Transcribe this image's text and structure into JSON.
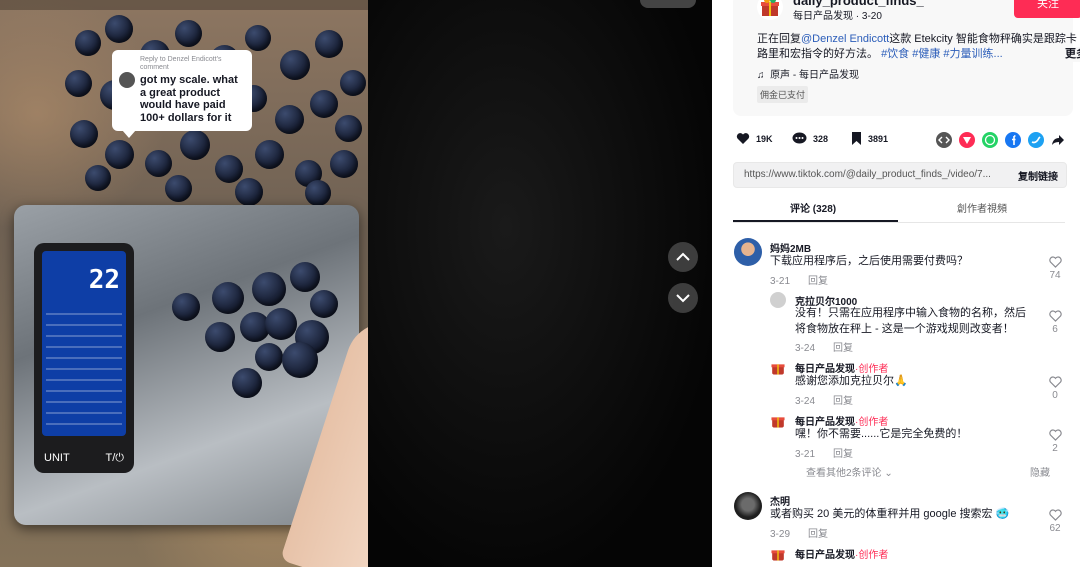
{
  "video": {
    "bubble_reply_to": "Reply to Denzel Endicott's comment",
    "bubble_text": "got my scale. what a great product would have paid 100+ dollars for it",
    "scale_reading": "22",
    "scale_unit_label": "UNIT",
    "scale_tare_label": "T/⏻",
    "nav_up_icon": "chevron-up-icon",
    "nav_down_icon": "chevron-down-icon"
  },
  "author": {
    "username": "daily_product_finds_",
    "nickname": "每日产品发现",
    "date": "3-20",
    "follow_label": "关注"
  },
  "description": {
    "prefix": "正在回复",
    "mention": "@Denzel Endicott",
    "body": "这款 Etekcity 智能食物秤确实是跟踪卡路里和宏指令的好方法。",
    "tags": "#饮食 #健康 #力量训练...",
    "more_label": "更多",
    "music": "原声 - 每日产品发现",
    "paid_label": "佣金已支付"
  },
  "stats": {
    "likes": "19K",
    "comments": "328",
    "saves": "3891"
  },
  "share": {
    "icons": [
      "embed-icon",
      "send-icon",
      "whatsapp-icon",
      "facebook-icon",
      "twitter-icon",
      "share-arrow-icon"
    ],
    "colors": [
      "#555555",
      "#fe2c55",
      "#25d366",
      "#1877f2",
      "#1da1f2",
      "#161823"
    ]
  },
  "link": {
    "url": "https://www.tiktok.com/@daily_product_finds_/video/7...",
    "copy_label": "复制链接"
  },
  "tabs": {
    "comments": "评论 (328)",
    "creator_videos": "創作者視頻"
  },
  "comments": [
    {
      "name": "妈妈2MB",
      "text": "下载应用程序后，之后使用需要付费吗？",
      "date": "3-21",
      "reply": "回复",
      "likes": "74"
    },
    {
      "name": "克拉贝尔1000",
      "text": "没有！只需在应用程序中输入食物的名称，然后将食物放在秤上 - 这是一个游戏规则改变者！",
      "date": "3-24",
      "reply": "回复",
      "likes": "6"
    },
    {
      "name": "每日产品发现",
      "creator": "·创作者",
      "text": "感谢您添加克拉贝尔🙏",
      "date": "3-24",
      "reply": "回复",
      "likes": "0"
    },
    {
      "name": "每日产品发现",
      "creator": "·创作者",
      "text": "嘿！你不需要......它是完全免费的！",
      "date": "3-21",
      "reply": "回复",
      "likes": "2"
    },
    {
      "name": "杰明",
      "text": "或者购买 20 美元的体重秤并用 google 搜索宏 🥶",
      "date": "3-29",
      "reply": "回复",
      "likes": "62"
    },
    {
      "name": "每日产品发现",
      "creator": "·创作者"
    }
  ],
  "more_replies": "查看其他2条评论",
  "hide_label": "隐藏"
}
